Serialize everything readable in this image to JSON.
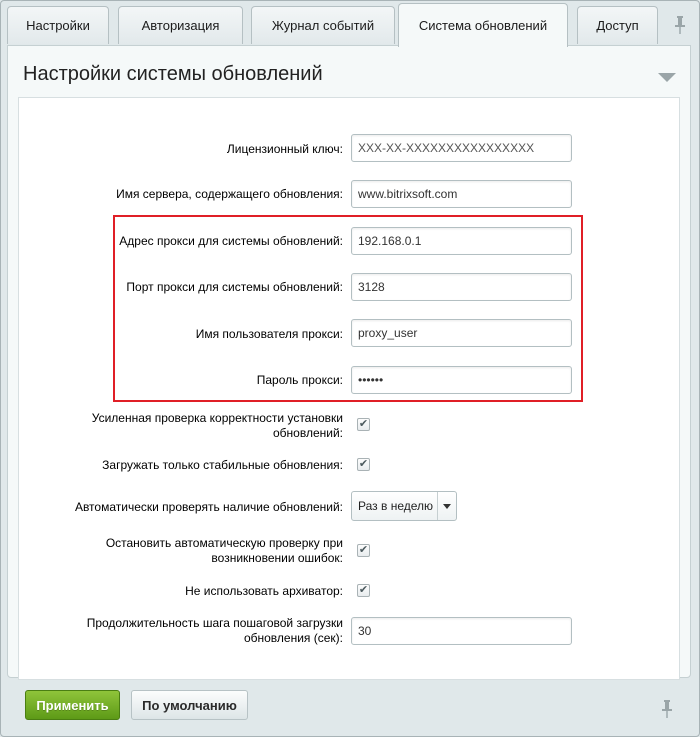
{
  "tabs": [
    {
      "label": "Настройки",
      "active": false
    },
    {
      "label": "Авторизация",
      "active": false
    },
    {
      "label": "Журнал событий",
      "active": false
    },
    {
      "label": "Система обновлений",
      "active": true
    },
    {
      "label": "Доступ",
      "active": false
    }
  ],
  "panel": {
    "title": "Настройки системы обновлений"
  },
  "fields": {
    "license_key": {
      "label": "Лицензионный ключ:",
      "value": "XXX-XX-XXXXXXXXXXXXXXXX"
    },
    "server_name": {
      "label": "Имя сервера, содержащего обновления:",
      "value": "www.bitrixsoft.com"
    },
    "proxy_address": {
      "label": "Адрес прокси для системы обновлений:",
      "value": "192.168.0.1"
    },
    "proxy_port": {
      "label": "Порт прокси для системы обновлений:",
      "value": "3128"
    },
    "proxy_user": {
      "label": "Имя пользователя прокси:",
      "value": "proxy_user"
    },
    "proxy_password": {
      "label": "Пароль прокси:",
      "value": "••••••"
    },
    "strict_check": {
      "label_line1": "Усиленная проверка корректности установки",
      "label_line2": "обновлений:",
      "checked": true
    },
    "stable_only": {
      "label": "Загружать только стабильные обновления:",
      "checked": true
    },
    "auto_check": {
      "label": "Автоматически проверять наличие обновлений:",
      "value": "Раз в неделю"
    },
    "stop_on_error": {
      "label_line1": "Остановить автоматическую проверку при",
      "label_line2": "возникновении ошибок:",
      "checked": true
    },
    "no_archiver": {
      "label": "Не использовать архиватор:",
      "checked": true
    },
    "step_duration": {
      "label_line1": "Продолжительность шага пошаговой загрузки",
      "label_line2": "обновления (сек):",
      "value": "30"
    }
  },
  "footer": {
    "apply_label": "Применить",
    "default_label": "По умолчанию"
  },
  "colors": {
    "highlight": "#e01f26",
    "apply_button": "#6fa824"
  },
  "icons": {
    "pin": "pin-icon",
    "collapse": "collapse-arrow-icon",
    "check": "checkmark-icon",
    "dropdown": "chevron-down-icon"
  }
}
